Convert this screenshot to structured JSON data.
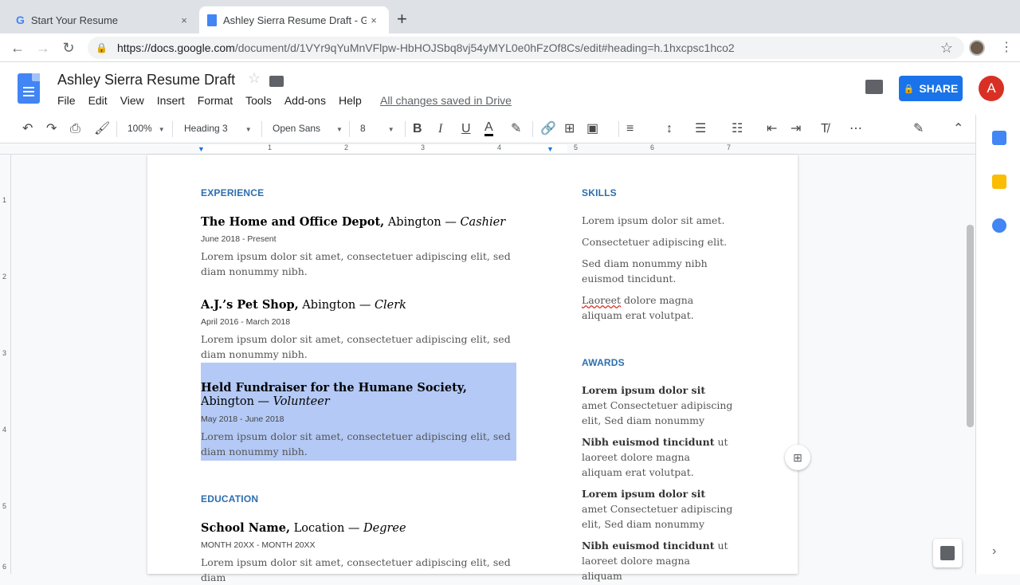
{
  "browser": {
    "tabs": [
      {
        "title": "Start Your Resume",
        "close": "×"
      },
      {
        "title": "Ashley Sierra Resume Draft - G",
        "close": "×"
      }
    ],
    "new_tab": "+",
    "url_host": "https://docs.google.com",
    "url_path": "/document/d/1VYr9qYuMnVFlpw-HbHOJSbq8vj54yMYL0e0hFzOf8Cs/edit#heading=h.1hxcpsc1hco2"
  },
  "docs": {
    "title": "Ashley Sierra Resume Draft",
    "menus": [
      "File",
      "Edit",
      "View",
      "Insert",
      "Format",
      "Tools",
      "Add-ons",
      "Help"
    ],
    "saved_status": "All changes saved in Drive",
    "share_label": "SHARE",
    "avatar_letter": "A"
  },
  "format_bar": {
    "zoom": "100%",
    "style": "Heading 3",
    "font": "Open Sans",
    "size": "8"
  },
  "ruler": {
    "numbers": [
      "1",
      "2",
      "3",
      "4",
      "5",
      "6",
      "7"
    ],
    "vnumbers": [
      "1",
      "2",
      "3",
      "4",
      "5",
      "6"
    ]
  },
  "resume": {
    "experience_heading": "EXPERIENCE",
    "jobs": [
      {
        "org": "The Home and Office Depot,",
        "loc": " Abington — ",
        "role": "Cashier",
        "dates": "June 2018 - Present",
        "desc": "Lorem ipsum dolor sit amet, consectetuer adipiscing elit, sed diam nonummy nibh."
      },
      {
        "org": "A.J.’s Pet Shop,",
        "loc": " Abington — ",
        "role": "Clerk",
        "dates": "April 2016 - March 2018",
        "desc": "Lorem ipsum dolor sit amet, consectetuer adipiscing elit, sed diam nonummy nibh."
      },
      {
        "org": "Held Fundraiser for the Humane Society,",
        "loc": " Abington — ",
        "role": "Volunteer",
        "dates": "May 2018 - June 2018",
        "desc": "Lorem ipsum dolor sit amet, consectetuer adipiscing elit, sed diam nonummy nibh."
      }
    ],
    "education_heading": "EDUCATION",
    "school": {
      "org": "School Name,",
      "loc": " Location — ",
      "role": "Degree",
      "dates": "MONTH 20XX - MONTH 20XX",
      "desc": "Lorem ipsum dolor sit amet, consectetuer adipiscing elit, sed diam"
    },
    "skills_heading": "SKILLS",
    "skills": [
      "Lorem ipsum dolor sit amet.",
      "Consectetuer adipiscing elit.",
      "Sed diam nonummy nibh euismod tincidunt."
    ],
    "skill4_a": "Laoreet",
    "skill4_b": " dolore magna aliquam erat volutpat.",
    "awards_heading": "AWARDS",
    "awards": [
      {
        "bold": "Lorem ipsum dolor sit",
        "rest": " amet Consectetuer adipiscing elit, Sed diam nonummy"
      },
      {
        "bold": "Nibh euismod tincidunt",
        "rest": " ut laoreet dolore magna aliquam erat volutpat."
      },
      {
        "bold": "Lorem ipsum dolor sit",
        "rest": " amet Consectetuer adipiscing elit, Sed diam nonummy"
      },
      {
        "bold": "Nibh euismod tincidunt",
        "rest": " ut laoreet dolore magna aliquam"
      }
    ]
  },
  "colors": {
    "accent": "#2c6eaf",
    "share": "#1a73e8",
    "selection": "#b4c9f5"
  }
}
